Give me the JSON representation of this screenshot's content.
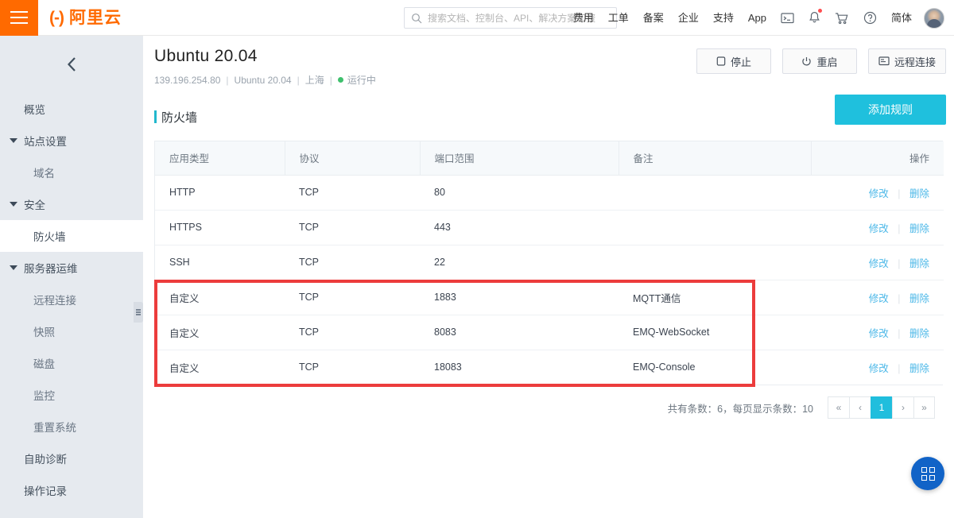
{
  "topbar": {
    "menu_icon": "hamburger-icon",
    "brand_mark": "(-)",
    "brand_text": "阿里云",
    "search": {
      "icon": "search-icon",
      "placeholder": "搜索文档、控制台、API、解决方案和资",
      "value": ""
    },
    "nav_items": [
      {
        "label": "费用"
      },
      {
        "label": "工单"
      },
      {
        "label": "备案"
      },
      {
        "label": "企业"
      },
      {
        "label": "支持"
      },
      {
        "label": "App"
      }
    ],
    "icons": [
      {
        "name": "terminal-icon"
      },
      {
        "name": "bell-icon",
        "has_badge": true
      },
      {
        "name": "cart-icon"
      },
      {
        "name": "help-icon"
      }
    ],
    "language_label": "简体",
    "avatar": "user-avatar"
  },
  "sidebar": {
    "back_icon": "chevron-left-icon",
    "collapse_handle": "sidebar-collapse-handle",
    "items": [
      {
        "label": "概览",
        "level": 0,
        "group": false,
        "active": false
      },
      {
        "label": "站点设置",
        "level": 0,
        "group": true,
        "active": false
      },
      {
        "label": "域名",
        "level": 1,
        "group": false,
        "active": false
      },
      {
        "label": "安全",
        "level": 0,
        "group": true,
        "active": false
      },
      {
        "label": "防火墙",
        "level": 1,
        "group": false,
        "active": true
      },
      {
        "label": "服务器运维",
        "level": 0,
        "group": true,
        "active": false
      },
      {
        "label": "远程连接",
        "level": 1,
        "group": false,
        "active": false
      },
      {
        "label": "快照",
        "level": 1,
        "group": false,
        "active": false
      },
      {
        "label": "磁盘",
        "level": 1,
        "group": false,
        "active": false
      },
      {
        "label": "监控",
        "level": 1,
        "group": false,
        "active": false
      },
      {
        "label": "重置系统",
        "level": 1,
        "group": false,
        "active": false
      },
      {
        "label": "自助诊断",
        "level": 0,
        "group": false,
        "active": false
      },
      {
        "label": "操作记录",
        "level": 0,
        "group": false,
        "active": false
      }
    ]
  },
  "header": {
    "title": "Ubuntu 20.04",
    "ip": "139.196.254.80",
    "os": "Ubuntu 20.04",
    "region": "上海",
    "status": "运行中",
    "status_color": "#3fc06d",
    "actions": [
      {
        "label": "停止",
        "icon": "stop-icon"
      },
      {
        "label": "重启",
        "icon": "power-icon"
      },
      {
        "label": "远程连接",
        "icon": "remote-desktop-icon"
      }
    ]
  },
  "section": {
    "title": "防火墙",
    "accent_color": "#21b8cd",
    "add_rule_label": "添加规则",
    "add_rule_color": "#1fc0dd"
  },
  "table": {
    "columns": [
      "应用类型",
      "协议",
      "端口范围",
      "备注",
      "操作"
    ],
    "rows": [
      {
        "app_type": "HTTP",
        "protocol": "TCP",
        "port": "80",
        "note": "",
        "edit": "修改",
        "delete": "删除"
      },
      {
        "app_type": "HTTPS",
        "protocol": "TCP",
        "port": "443",
        "note": "",
        "edit": "修改",
        "delete": "删除"
      },
      {
        "app_type": "SSH",
        "protocol": "TCP",
        "port": "22",
        "note": "",
        "edit": "修改",
        "delete": "删除"
      },
      {
        "app_type": "自定义",
        "protocol": "TCP",
        "port": "1883",
        "note": "MQTT通信",
        "edit": "修改",
        "delete": "删除"
      },
      {
        "app_type": "自定义",
        "protocol": "TCP",
        "port": "8083",
        "note": "EMQ-WebSocket",
        "edit": "修改",
        "delete": "删除"
      },
      {
        "app_type": "自定义",
        "protocol": "TCP",
        "port": "18083",
        "note": "EMQ-Console",
        "edit": "修改",
        "delete": "删除"
      }
    ]
  },
  "annotation": {
    "highlight_color": "#ec3c3c",
    "highlight_target": "custom-rule-rows"
  },
  "pagination": {
    "info": "共有条数：6，每页显示条数：10",
    "first": "«",
    "prev": "‹",
    "current": "1",
    "next": "›",
    "last": "»"
  },
  "fab": {
    "icon": "grid-apps-icon",
    "color": "#1163c7"
  }
}
